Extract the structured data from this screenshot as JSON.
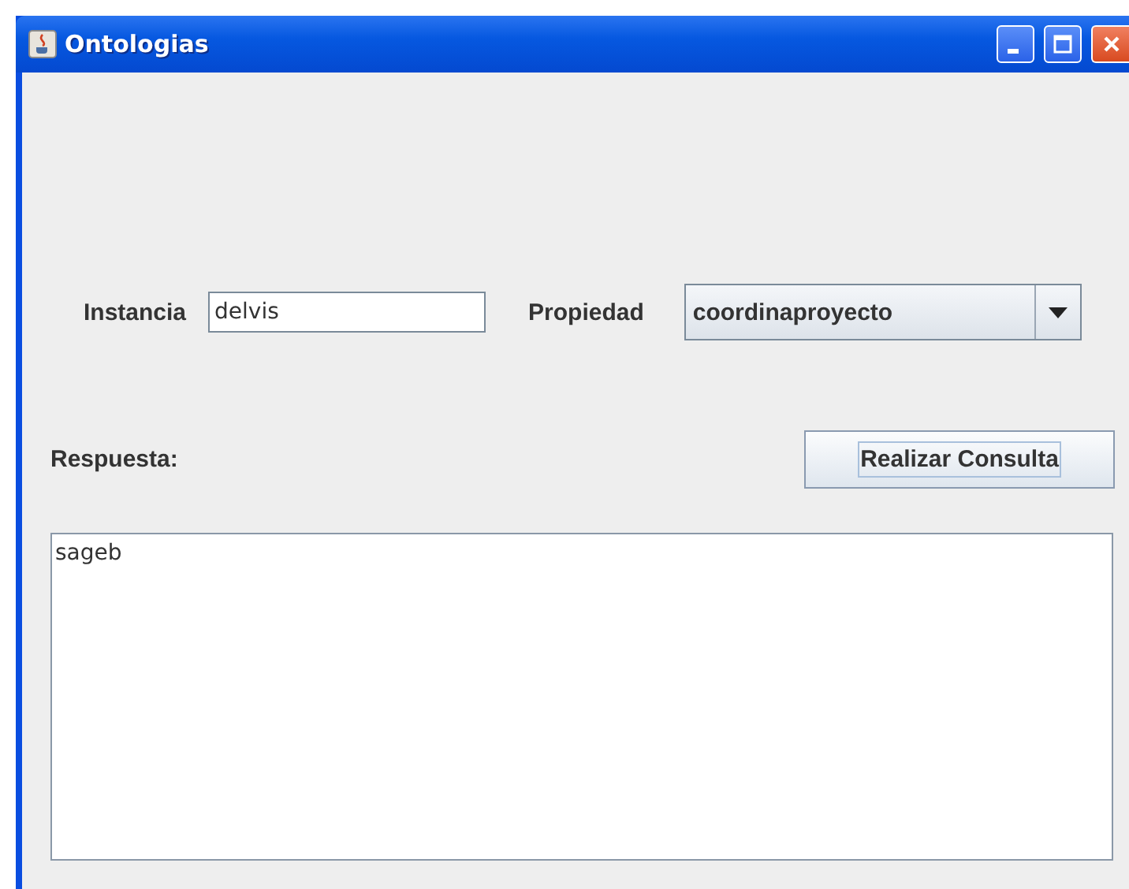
{
  "window": {
    "title": "Ontologias"
  },
  "form": {
    "instance_label": "Instancia",
    "instance_value": "delvis",
    "property_label": "Propiedad",
    "property_value": "coordinaproyecto"
  },
  "answer_label": "Respuesta:",
  "query_button": "Realizar Consulta",
  "answer_text": "sageb"
}
